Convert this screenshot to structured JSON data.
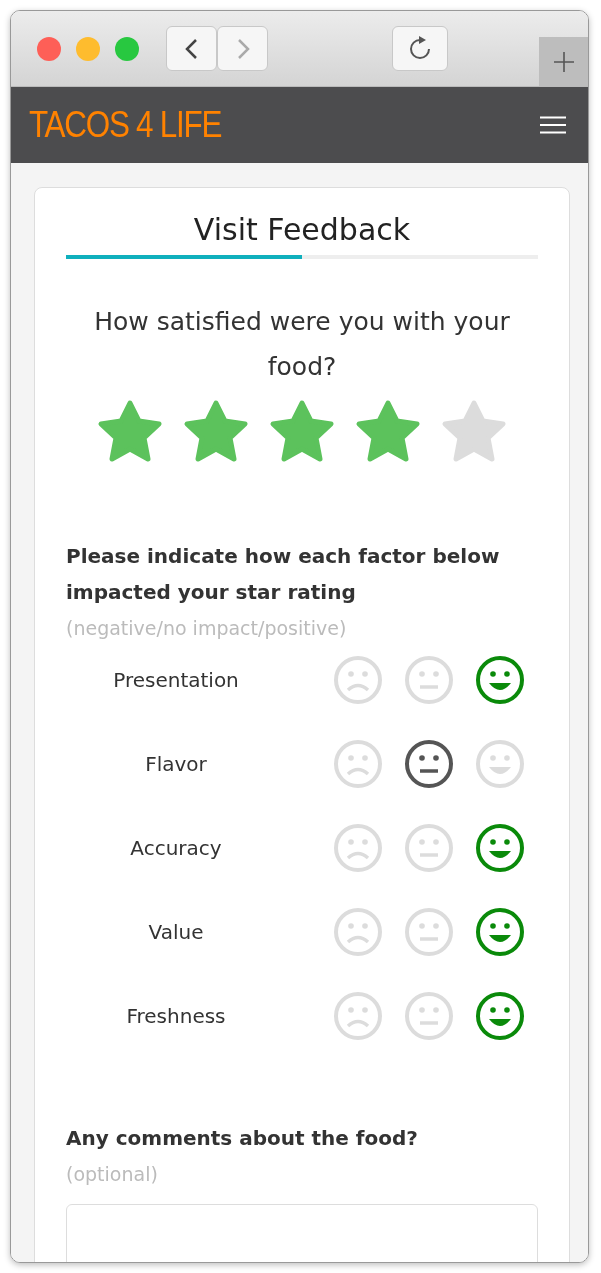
{
  "browser": {
    "back_disabled": false,
    "forward_disabled": true
  },
  "site": {
    "logo": "TACOS 4 LIFE"
  },
  "card": {
    "title": "Visit Feedback",
    "progress": {
      "level": 0.5
    },
    "question": "How satisfied were you with your food?",
    "stars": 4,
    "factors_heading": "Please indicate how each factor below impacted your star rating",
    "factors_hint": "(negative/no impact/positive)",
    "factors": [
      {
        "label": "Presentation",
        "faces": [
          {
            "kind": "negative",
            "selected": false
          },
          {
            "kind": "neutral",
            "selected": false
          },
          {
            "kind": "positive",
            "selected": true
          }
        ]
      },
      {
        "label": "Flavor",
        "faces": [
          {
            "kind": "negative",
            "selected": false
          },
          {
            "kind": "neutral",
            "selected": true
          },
          {
            "kind": "positive",
            "selected": false
          }
        ]
      },
      {
        "label": "Accuracy",
        "faces": [
          {
            "kind": "negative",
            "selected": false
          },
          {
            "kind": "neutral",
            "selected": false
          },
          {
            "kind": "positive",
            "selected": true
          }
        ]
      },
      {
        "label": "Value",
        "faces": [
          {
            "kind": "negative",
            "selected": false
          },
          {
            "kind": "neutral",
            "selected": false
          },
          {
            "kind": "positive",
            "selected": true
          }
        ]
      },
      {
        "label": "Freshness",
        "faces": [
          {
            "kind": "negative",
            "selected": false
          },
          {
            "kind": "neutral",
            "selected": false
          },
          {
            "kind": "positive",
            "selected": true
          }
        ]
      }
    ],
    "comments_heading": "Any comments about the food?",
    "comments_hint": "(optional)"
  }
}
